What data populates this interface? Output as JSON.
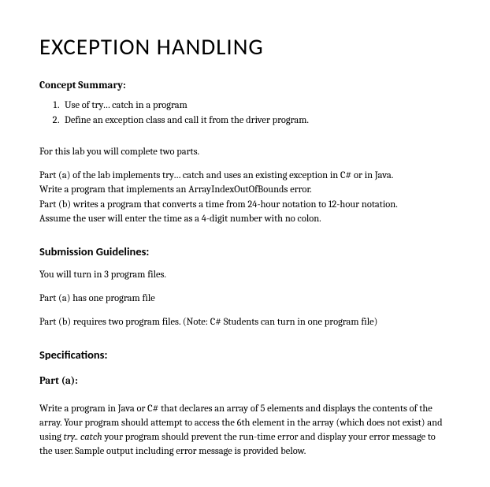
{
  "title": "EXCEPTION HANDLING",
  "concept": {
    "heading": "Concept Summary:",
    "items": [
      "Use of try… catch in a program",
      "Define an exception class and call it from the driver program."
    ]
  },
  "intro": {
    "line1": "For this lab you will complete two parts.",
    "partA_1": "Part (a) of the lab implements try… catch and uses an existing exception in C# or in Java.",
    "partA_2": "Write a program that implements an ArrayIndexOutOfBounds error.",
    "partB_1": "Part (b) writes a program that converts a time from 24-hour notation to 12-hour notation.",
    "partB_2": "Assume the user will enter the time as a 4-digit number with no colon."
  },
  "submission": {
    "heading": "Submission Guidelines:",
    "line1": "You will turn in 3 program files.",
    "line2": "Part (a) has one program file",
    "line3": "Part (b) requires two program files. (Note: C# Students can turn in one program file)"
  },
  "specs": {
    "heading": "Specifications:",
    "partA": {
      "heading": "Part (a):",
      "text_before_italic": "Write a program in Java or C# that declares an array of 5 elements and displays the contents of the array. Your program should attempt to access the 6th element in the array (which does not exist) and using  ",
      "italic": "try.. catch",
      "text_after_italic": " your program should prevent the run-time error and display your error message to the user. Sample output including error message is provided below."
    }
  }
}
